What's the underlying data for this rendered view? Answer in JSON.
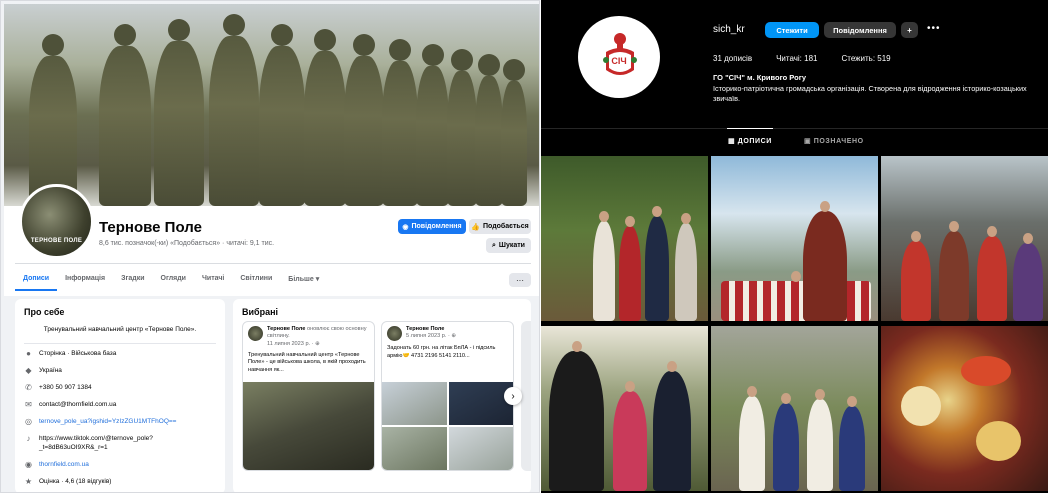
{
  "facebook": {
    "page_name": "Тернове Поле",
    "stats": "8,6 тис. позначок(-ки) «Подобається» · читачі: 9,1 тис.",
    "avatar_text": "ТЕРНОВЕ ПОЛЕ",
    "buttons": {
      "message": "Повідомлення",
      "like": "Подобається",
      "search": "Шукати"
    },
    "tabs": [
      "Дописи",
      "Інформація",
      "Згадки",
      "Огляди",
      "Читачі",
      "Світлини",
      "Більше ▾"
    ],
    "active_tab": "Дописи",
    "more_dots": "···",
    "about": {
      "title": "Про себе",
      "description": "Тренувальний навчальний центр «Тернове Поле».",
      "items": [
        {
          "icon": "info-icon",
          "glyph": "●",
          "text": "Сторінка · Військова база",
          "bold_prefix": "Сторінка"
        },
        {
          "icon": "location-icon",
          "glyph": "◆",
          "text": "Україна"
        },
        {
          "icon": "phone-icon",
          "glyph": "✆",
          "text": "+380 50 907 1384"
        },
        {
          "icon": "email-icon",
          "glyph": "✉",
          "text": "contact@thornfield.com.ua"
        },
        {
          "icon": "instagram-icon",
          "glyph": "◎",
          "text": "ternove_pole_ua?igshid=YzIzZGU1MTFhOQ==",
          "link": true
        },
        {
          "icon": "tiktok-icon",
          "glyph": "♪",
          "text": "https://www.tiktok.com/@ternove_pole?_t=8dB63uOI9XR&_r=1"
        },
        {
          "icon": "website-icon",
          "glyph": "◉",
          "text": "thornfield.com.ua",
          "link": true
        },
        {
          "icon": "star-icon",
          "glyph": "★",
          "text": "Оцінка · 4,6 (18 відгуків)"
        }
      ]
    },
    "featured": {
      "title": "Вибрані",
      "cards": [
        {
          "author": "Тернове Поле",
          "action": "оновлює свою основну світлину.",
          "date": "11 липня 2023 р. · ⊕",
          "text": "Тренувальний навчальний центр «Тернове Поле» - це військова школа, в якій проходить навчання як..."
        },
        {
          "author": "Тернове Поле",
          "action": "",
          "date": "5 липня 2023 р. · ⊕",
          "text": "Задонать 60 грн. на літак БпЛА - і підсиль армію🤝 4731 2196 5141 2110..."
        }
      ],
      "next_arrow": "›"
    }
  },
  "instagram": {
    "username": "sich_kr",
    "follow_label": "Стежити",
    "message_label": "Повідомлення",
    "adduser_glyph": "+",
    "dots": "•••",
    "stats": {
      "posts": "31 дописів",
      "followers": "Читачі: 181",
      "following": "Стежить: 519"
    },
    "display_name": "ГО \"СІЧ\" м. Кривого Рогу",
    "bio": "Історико-патріотична громадська організація. Створена для відродження історико-козацьких звичаїв.",
    "tabs": {
      "posts": "▦ ДОПИСИ",
      "tagged": "▣ ПОЗНАЧЕНО"
    },
    "logo_text": "СІЧ"
  }
}
